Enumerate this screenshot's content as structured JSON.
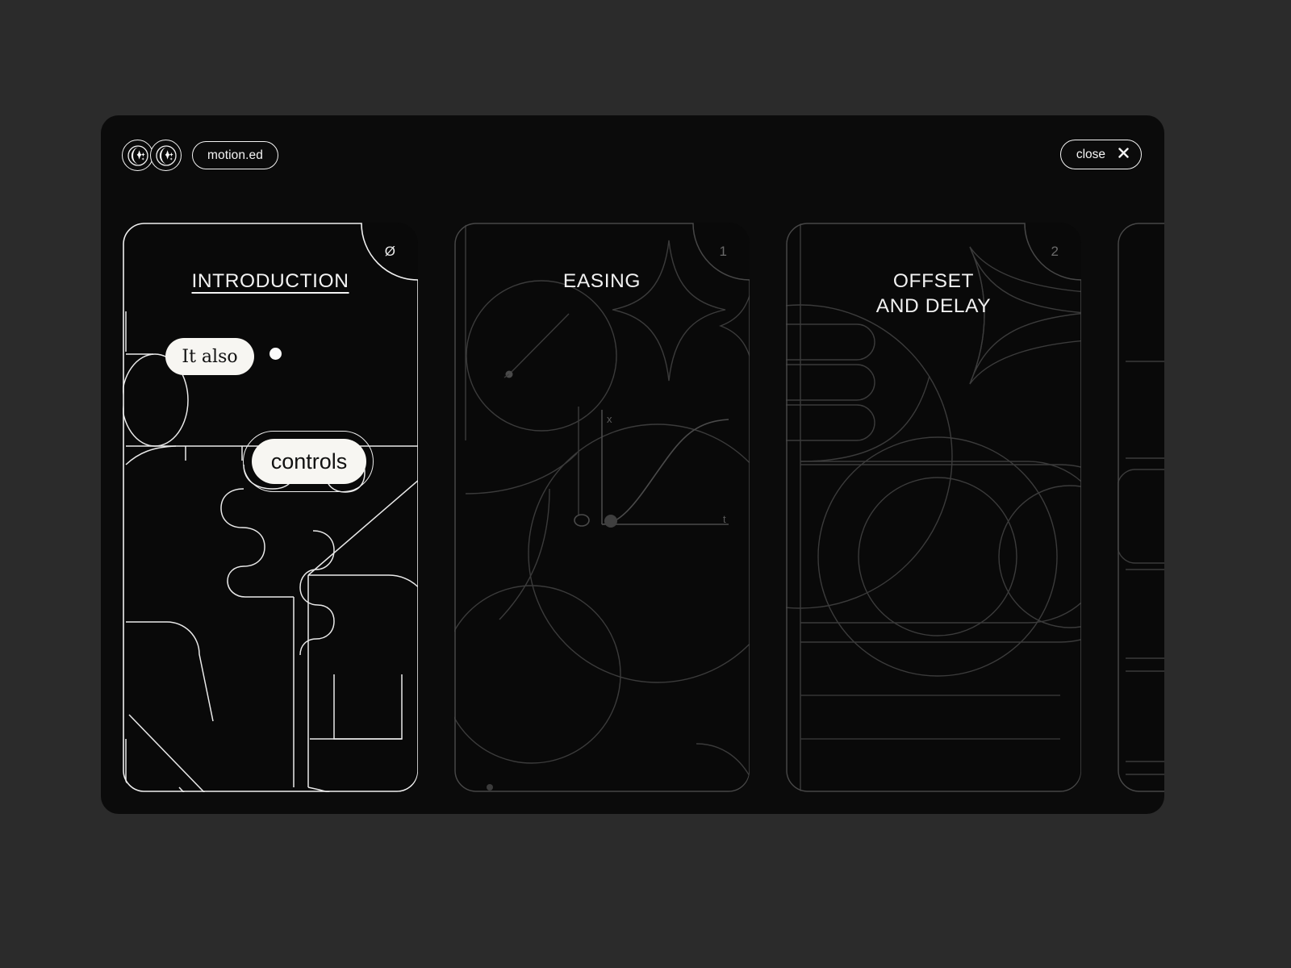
{
  "theme": {
    "page_bg": "#2b2b2b",
    "panel_bg": "#0b0b0b",
    "stroke_active": "#f2f2f2",
    "stroke_dim": "#3a3a3a",
    "text": "#f3f3f3",
    "pill_fill": "#f7f6f2"
  },
  "header": {
    "brand_label": "motion.ed",
    "logo_icon_1": "moon-sparkle-icon",
    "logo_icon_2": "moon-sparkle-icon",
    "close_label": "close",
    "close_icon": "close-icon"
  },
  "cards": [
    {
      "number": "Ø",
      "title": "INTRODUCTION",
      "state": "active",
      "annotations": [
        {
          "text": "It also"
        },
        {
          "text": "controls"
        }
      ]
    },
    {
      "number": "1",
      "title": "EASING",
      "state": "dim",
      "graph_labels": {
        "y": "x",
        "t": "t"
      }
    },
    {
      "number": "2",
      "title": "OFFSET\nAND DELAY",
      "title_line_1": "OFFSET",
      "title_line_2": "AND DELAY",
      "state": "dim"
    },
    {
      "number": "",
      "title": "",
      "state": "dim"
    }
  ]
}
